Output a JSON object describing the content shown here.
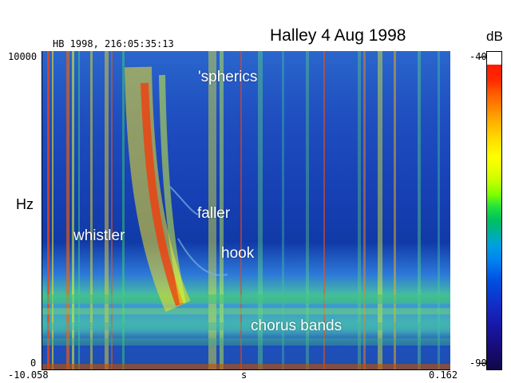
{
  "title": "Halley 4 Aug 1998",
  "header": "HB 1998, 216:05:35:13",
  "y_axis": {
    "top": "10000",
    "bottom": "0",
    "label": "Hz"
  },
  "x_axis": {
    "left": "-10.058",
    "center": "s",
    "right": "0.162"
  },
  "annotations": {
    "sferics": "'spherics",
    "whistler": "whistler",
    "faller": "faller",
    "hook": "hook",
    "chorus": "chorus bands"
  },
  "colorbar": {
    "unit": "dB",
    "top": "-40",
    "bottom": "-90"
  },
  "colors": {
    "low": "#10084a",
    "mid": "#20e040",
    "high": "#ff1a00",
    "saturated": "#ffffff"
  }
}
